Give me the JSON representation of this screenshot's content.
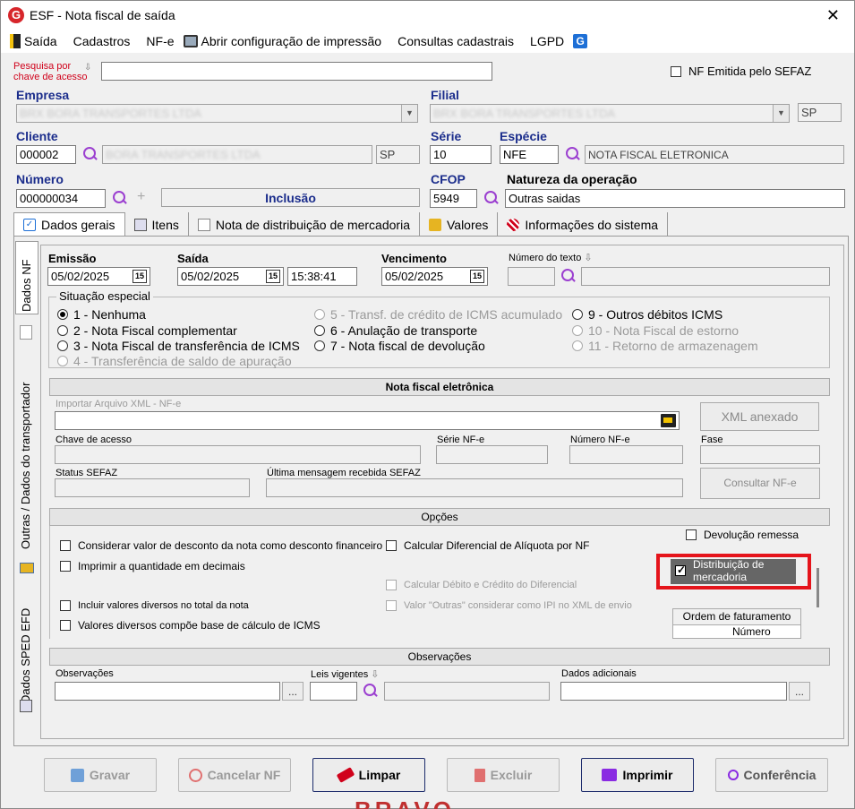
{
  "window": {
    "title": "ESF - Nota fiscal de saída",
    "logo_letter": "G"
  },
  "menu": [
    "Saída",
    "Cadastros",
    "NF-e",
    "Abrir configuração de impressão",
    "Consultas cadastrais",
    "LGPD"
  ],
  "search": {
    "label": "Pesquisa por chave de acesso",
    "label_line1": "Pesquisa por",
    "label_line2": "chave de acesso",
    "value": ""
  },
  "nf_sefaz": {
    "label": "NF Emitida pelo SEFAZ"
  },
  "labels": {
    "empresa": "Empresa",
    "filial": "Filial",
    "cliente": "Cliente",
    "serie": "Série",
    "especie": "Espécie",
    "numero": "Número",
    "cfop": "CFOP",
    "natureza": "Natureza da operação"
  },
  "values": {
    "empresa": "BRX BORA TRANSPORTES LTDA",
    "filial": "BRX BORA TRANSPORTES LTDA",
    "filial_uf": "SP",
    "cliente_code": "000002",
    "cliente_name": "BORA TRANSPORTES LTDA",
    "cliente_uf": "SP",
    "serie": "10",
    "especie_code": "NFE",
    "especie_desc": "NOTA FISCAL ELETRONICA",
    "numero": "000000034",
    "status": "Inclusão",
    "cfop": "5949",
    "natureza": "Outras saidas"
  },
  "tabs": [
    "Dados gerais",
    "Itens",
    "Nota de distribuição de mercadoria",
    "Valores",
    "Informações do sistema"
  ],
  "side_tabs": [
    "Dados NF",
    "Outras / Dados do transportador",
    "Dados SPED EFD"
  ],
  "dates": {
    "emissao_label": "Emissão",
    "emissao": "05/02/2025",
    "saida_label": "Saída",
    "saida": "05/02/2025",
    "saida_hora": "15:38:41",
    "vencimento_label": "Vencimento",
    "vencimento": "05/02/2025",
    "numero_texto_label": "Número do texto",
    "cal_glyph": "15"
  },
  "situacao": {
    "legend": "Situação especial",
    "options": [
      "1 - Nenhuma",
      "2 - Nota Fiscal complementar",
      "3 - Nota Fiscal de transferência de ICMS",
      "4 - Transferência de saldo de apuração",
      "5 - Transf. de crédito de ICMS acumulado",
      "6 - Anulação de transporte",
      "7 - Nota fiscal de devolução",
      "9 - Outros débitos ICMS",
      "10 - Nota Fiscal de estorno",
      "11 - Retorno de armazenagem"
    ]
  },
  "nfe": {
    "header": "Nota fiscal eletrônica",
    "import_label": "Importar Arquivo XML - NF-e",
    "xml_button": "XML anexado",
    "chave_label": "Chave de acesso",
    "serie_label": "Série NF-e",
    "numero_label": "Número NF-e",
    "fase_label": "Fase",
    "status_label": "Status SEFAZ",
    "ultima_label": "Última mensagem recebida SEFAZ",
    "consultar_button": "Consultar NF-e"
  },
  "opcoes": {
    "header": "Opções",
    "items": [
      "Considerar valor de desconto da nota como desconto financeiro",
      "Calcular Diferencial de Alíquota por NF",
      "Imprimir a quantidade em decimais",
      "Calcular Débito e Crédito do Diferencial",
      "Incluir valores diversos no total da nota",
      "Valor \"Outras\" considerar como IPI no XML de envio",
      "Valores diversos compõe base de cálculo de ICMS",
      "Devolução remessa",
      "Distribuição de mercadoria"
    ],
    "ordem_header": "Ordem de faturamento",
    "ordem_col": "Número"
  },
  "observacoes": {
    "header": "Observações",
    "obs_label": "Observações",
    "leis_label": "Leis vigentes",
    "dados_label": "Dados adicionais",
    "ellipsis": "..."
  },
  "buttons": [
    "Gravar",
    "Cancelar NF",
    "Limpar",
    "Excluir",
    "Imprimir",
    "Conferência"
  ],
  "footer_watermark": "BRAVO",
  "colors": {
    "accent_blue": "#1b2d8c",
    "search_red": "#d0021b",
    "highlight_red": "#e5141b",
    "magnifier": "#9b3fd0"
  }
}
